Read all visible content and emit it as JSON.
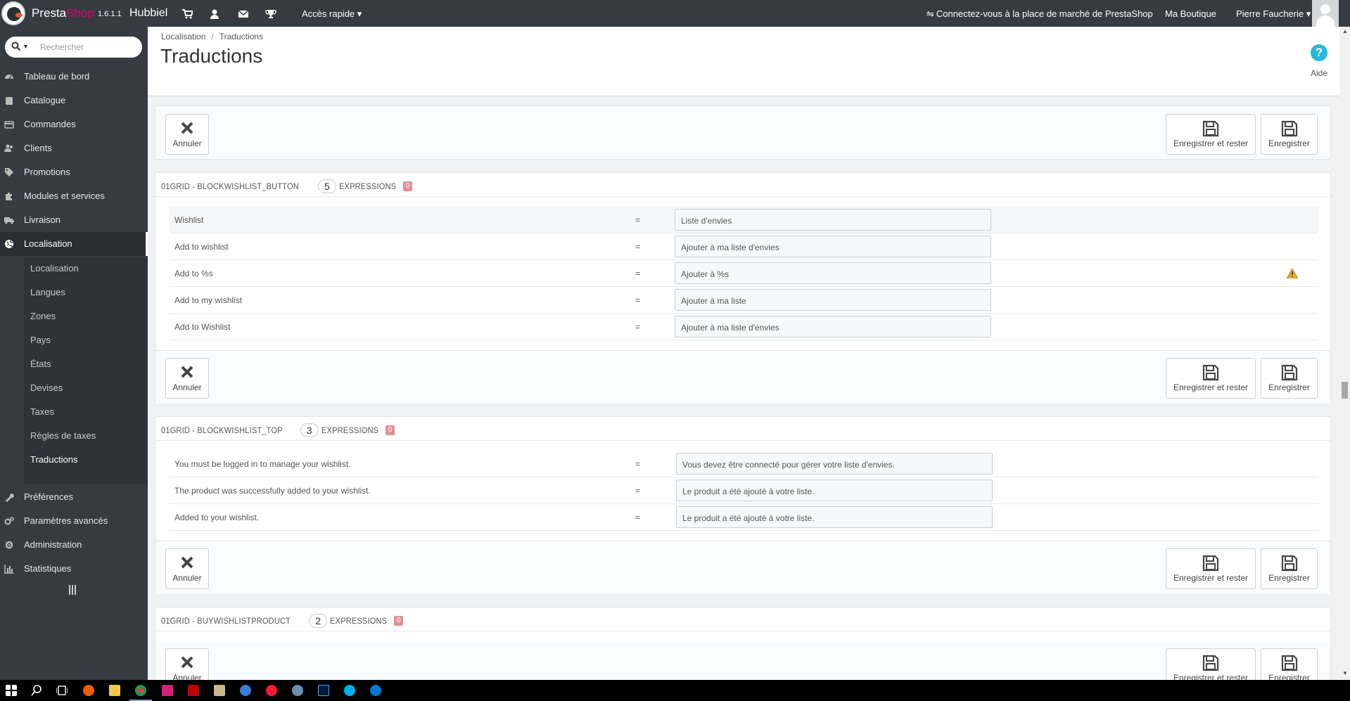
{
  "topbar": {
    "brand_presta": "Presta",
    "brand_shop": "Shop",
    "version": "1.6.1.1",
    "shop_name": "Hubbiel",
    "quick_access": "Accès rapide",
    "marketplace": "Connectez-vous à la place de marché de PrestaShop",
    "my_shop": "Ma Boutique",
    "user": "Pierre Faucherie"
  },
  "sidebar": {
    "search_placeholder": "Rechercher",
    "items": [
      {
        "label": "Tableau de bord",
        "icon": "dashboard-icon"
      },
      {
        "label": "Catalogue",
        "icon": "book-icon"
      },
      {
        "label": "Commandes",
        "icon": "credit-card-icon"
      },
      {
        "label": "Clients",
        "icon": "users-icon"
      },
      {
        "label": "Promotions",
        "icon": "tag-icon"
      },
      {
        "label": "Modules et services",
        "icon": "puzzle-icon"
      },
      {
        "label": "Livraison",
        "icon": "truck-icon"
      },
      {
        "label": "Localisation",
        "icon": "globe-icon"
      },
      {
        "label": "Préférences",
        "icon": "wrench-icon"
      },
      {
        "label": "Paramètres avancés",
        "icon": "cogs-icon"
      },
      {
        "label": "Administration",
        "icon": "cog-icon"
      },
      {
        "label": "Statistiques",
        "icon": "bar-chart-icon"
      }
    ],
    "sub_items": [
      "Localisation",
      "Langues",
      "Zones",
      "Pays",
      "États",
      "Devises",
      "Taxes",
      "Règles de taxes",
      "Traductions"
    ]
  },
  "header": {
    "breadcrumb": [
      "Localisation",
      "Traductions"
    ],
    "title": "Traductions",
    "help": "Aide"
  },
  "buttons": {
    "cancel": "Annuler",
    "save_stay": "Enregistrer et rester",
    "save": "Enregistrer"
  },
  "sections": [
    {
      "title": "01GRID - BLOCKWISHLIST_BUTTON",
      "count": "5",
      "expressions": "EXPRESSIONS",
      "missing": "0",
      "rows": [
        {
          "source": "Wishlist",
          "eq": "=",
          "translation": "Liste d'envies",
          "warning": false
        },
        {
          "source": "Add to wishlist",
          "eq": "=",
          "translation": "Ajouter à ma liste d'envies",
          "warning": false
        },
        {
          "source": "Add to %s",
          "eq": "=",
          "translation": "Ajouter à %s",
          "warning": true
        },
        {
          "source": "Add to my wishlist",
          "eq": "=",
          "translation": "Ajouter à ma liste",
          "warning": false
        },
        {
          "source": "Add to Wishlist",
          "eq": "=",
          "translation": "Ajouter à ma liste d'envies",
          "warning": false
        }
      ]
    },
    {
      "title": "01GRID - BLOCKWISHLIST_TOP",
      "count": "3",
      "expressions": "EXPRESSIONS",
      "missing": "0",
      "rows": [
        {
          "source": "You must be logged in to manage your wishlist.",
          "eq": "=",
          "translation": "Vous devez être connecté pour gérer votre liste d'envies.",
          "warning": false
        },
        {
          "source": "The product was successfully added to your wishlist.",
          "eq": "=",
          "translation": "Le produit a été ajouté à votre liste.",
          "warning": false
        },
        {
          "source": "Added to your wishlist.",
          "eq": "=",
          "translation": "Le produit a été ajouté à votre liste.",
          "warning": false
        }
      ]
    },
    {
      "title": "01GRID - BUYWISHLISTPRODUCT",
      "count": "2",
      "expressions": "EXPRESSIONS",
      "missing": "0",
      "rows": []
    }
  ],
  "colors": {
    "topbar": "#363a41",
    "brand_pink": "#df0067",
    "help_blue": "#25b9d7",
    "missing_badge": "#e08f95"
  }
}
